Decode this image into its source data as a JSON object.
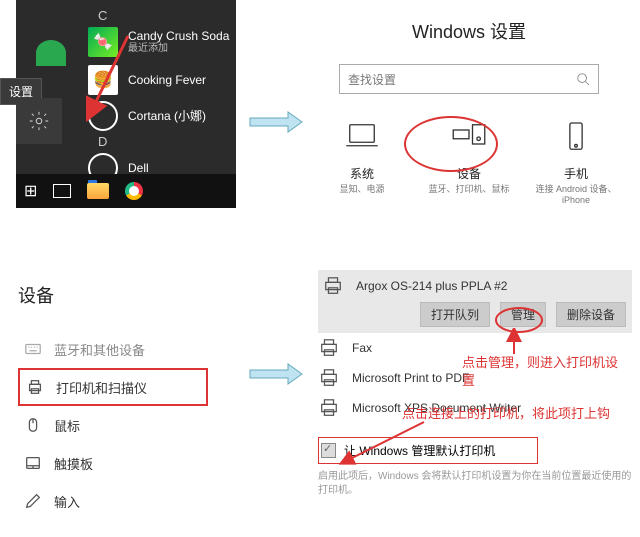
{
  "start": {
    "letter_c": "C",
    "letter_d": "D",
    "candy": "Candy Crush Soda",
    "candy_sub": "最近添加",
    "cooking": "Cooking Fever",
    "cortana": "Cortana (小娜)",
    "dell": "Dell",
    "tooltip": "设置"
  },
  "winSettings": {
    "title": "Windows 设置",
    "search_ph": "查找设置",
    "cats": {
      "sys": {
        "t": "系统",
        "s": "显知、电源"
      },
      "dev": {
        "t": "设备",
        "s": "蓝牙、打印机、鼠标"
      },
      "phone": {
        "t": "手机",
        "s": "连接 Android 设备、iPhone"
      }
    }
  },
  "sidebar": {
    "header": "设备",
    "items": {
      "bt": "蓝牙和其他设备",
      "pr": "打印机和扫描仪",
      "mouse": "鼠标",
      "touch": "触摸板",
      "input": "输入"
    }
  },
  "printers": {
    "p1": "Argox OS-214 plus PPLA #2",
    "p2": "Fax",
    "p3": "Microsoft Print to PDF",
    "p4": "Microsoft XPS Document Writer",
    "actions": {
      "queue": "打开队列",
      "manage": "管理",
      "remove": "删除设备"
    },
    "chk_label": "让 Windows 管理默认打印机",
    "help": "启用此项后，Windows 会将默认打印机设置为你在当前位置最近使用的打印机。"
  },
  "notes": {
    "n1": "点击管理，则进入打印机设置",
    "n2": "点击连接上的打印机，将此项打上钩"
  }
}
